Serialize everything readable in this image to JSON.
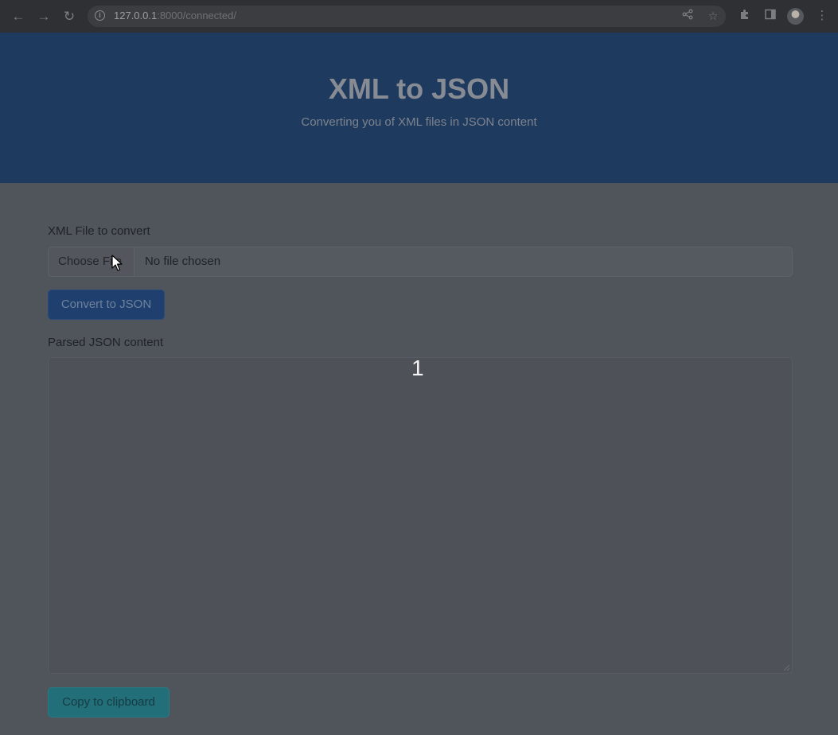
{
  "browser": {
    "url_host": "127.0.0.1",
    "url_rest": ":8000/connected/"
  },
  "header": {
    "title": "XML to JSON",
    "subtitle": "Converting you of XML files in JSON content"
  },
  "form": {
    "file_label": "XML File to convert",
    "file_button": "Choose File",
    "file_status": "No file chosen",
    "convert_button": "Convert to JSON",
    "output_label": "Parsed JSON content",
    "output_value": "",
    "copy_button": "Copy to clipboard"
  },
  "overlay": {
    "number": "1"
  },
  "colors": {
    "header_bg": "#1f3a5f",
    "primary_button": "#1f3f6e",
    "info_button": "#226e79",
    "page_bg": "#50545b"
  }
}
